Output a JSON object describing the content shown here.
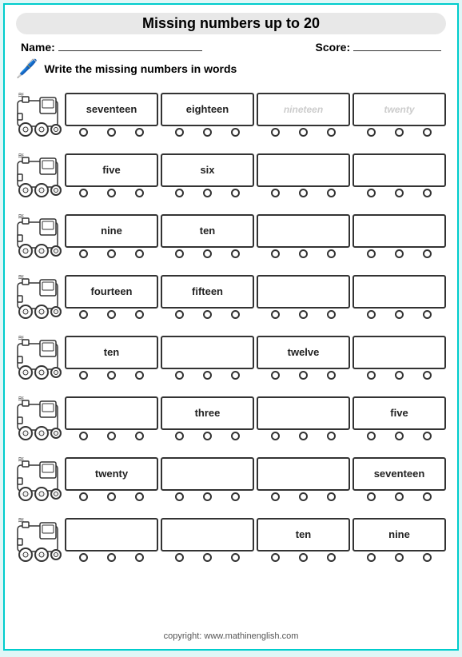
{
  "title": "Missing numbers up to 20",
  "name_label": "Name:",
  "score_label": "Score:",
  "instruction": "Write the missing numbers in words",
  "rows": [
    {
      "cars": [
        {
          "text": "seventeen",
          "placeholder": false
        },
        {
          "text": "eighteen",
          "placeholder": false
        },
        {
          "text": "nineteen",
          "placeholder": true
        },
        {
          "text": "twenty",
          "placeholder": true
        }
      ]
    },
    {
      "cars": [
        {
          "text": "five",
          "placeholder": false
        },
        {
          "text": "six",
          "placeholder": false
        },
        {
          "text": "",
          "placeholder": false
        },
        {
          "text": "",
          "placeholder": false
        }
      ]
    },
    {
      "cars": [
        {
          "text": "nine",
          "placeholder": false
        },
        {
          "text": "ten",
          "placeholder": false
        },
        {
          "text": "",
          "placeholder": false
        },
        {
          "text": "",
          "placeholder": false
        }
      ]
    },
    {
      "cars": [
        {
          "text": "fourteen",
          "placeholder": false
        },
        {
          "text": "fifteen",
          "placeholder": false
        },
        {
          "text": "",
          "placeholder": false
        },
        {
          "text": "",
          "placeholder": false
        }
      ]
    },
    {
      "cars": [
        {
          "text": "ten",
          "placeholder": false
        },
        {
          "text": "",
          "placeholder": false
        },
        {
          "text": "twelve",
          "placeholder": false
        },
        {
          "text": "",
          "placeholder": false
        }
      ]
    },
    {
      "cars": [
        {
          "text": "",
          "placeholder": false
        },
        {
          "text": "three",
          "placeholder": false
        },
        {
          "text": "",
          "placeholder": false
        },
        {
          "text": "five",
          "placeholder": false
        }
      ]
    },
    {
      "cars": [
        {
          "text": "twenty",
          "placeholder": false
        },
        {
          "text": "",
          "placeholder": false
        },
        {
          "text": "",
          "placeholder": false
        },
        {
          "text": "seventeen",
          "placeholder": false
        }
      ]
    },
    {
      "cars": [
        {
          "text": "",
          "placeholder": false
        },
        {
          "text": "",
          "placeholder": false
        },
        {
          "text": "ten",
          "placeholder": false
        },
        {
          "text": "nine",
          "placeholder": false
        }
      ]
    }
  ],
  "footer": "copyright:   www.mathinenglish.com"
}
